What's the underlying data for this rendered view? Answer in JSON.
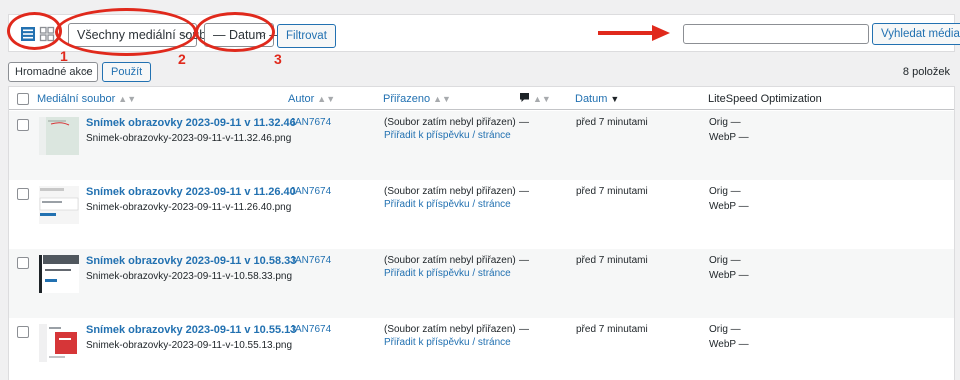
{
  "toolbar": {
    "filter_type": "Všechny mediální soubory",
    "filter_date": "— Datum —",
    "filter_button": "Filtrovat",
    "search_placeholder": "",
    "search_button": "Vyhledat média"
  },
  "annotations": {
    "n1": "1",
    "n2": "2",
    "n3": "3"
  },
  "bulk": {
    "action": "Hromadné akce",
    "apply": "Použít",
    "count": "8 položek"
  },
  "columns": {
    "file": "Mediální soubor",
    "author": "Autor",
    "attached": "Přiřazeno",
    "date": "Datum",
    "litespeed": "LiteSpeed Optimization"
  },
  "rows": [
    {
      "title": "Snímek obrazovky 2023-09-11 v 11.32.46",
      "filename": "Snimek-obrazovky-2023-09-11-v-11.32.46.png",
      "author": "JAN7674",
      "attached": "(Soubor zatím nebyl přiřazen)",
      "attach_link": "Přiřadit k příspěvku / stránce",
      "comments": "—",
      "date": "před 7 minutami",
      "orig": "Orig  —",
      "webp": "WebP  —"
    },
    {
      "title": "Snímek obrazovky 2023-09-11 v 11.26.40",
      "filename": "Snimek-obrazovky-2023-09-11-v-11.26.40.png",
      "author": "JAN7674",
      "attached": "(Soubor zatím nebyl přiřazen)",
      "attach_link": "Přiřadit k příspěvku / stránce",
      "comments": "—",
      "date": "před 7 minutami",
      "orig": "Orig  —",
      "webp": "WebP  —"
    },
    {
      "title": "Snímek obrazovky 2023-09-11 v 10.58.33",
      "filename": "Snimek-obrazovky-2023-09-11-v-10.58.33.png",
      "author": "JAN7674",
      "attached": "(Soubor zatím nebyl přiřazen)",
      "attach_link": "Přiřadit k příspěvku / stránce",
      "comments": "—",
      "date": "před 7 minutami",
      "orig": "Orig  —",
      "webp": "WebP  —"
    },
    {
      "title": "Snímek obrazovky 2023-09-11 v 10.55.13",
      "filename": "Snimek-obrazovky-2023-09-11-v-10.55.13.png",
      "author": "JAN7674",
      "attached": "(Soubor zatím nebyl přiřazen)",
      "attach_link": "Přiřadit k příspěvku / stránce",
      "comments": "—",
      "date": "před 7 minutami",
      "orig": "Orig  —",
      "webp": "WebP  —"
    }
  ],
  "colors": {
    "accent": "#2271b1",
    "annotation": "#e0291c"
  }
}
